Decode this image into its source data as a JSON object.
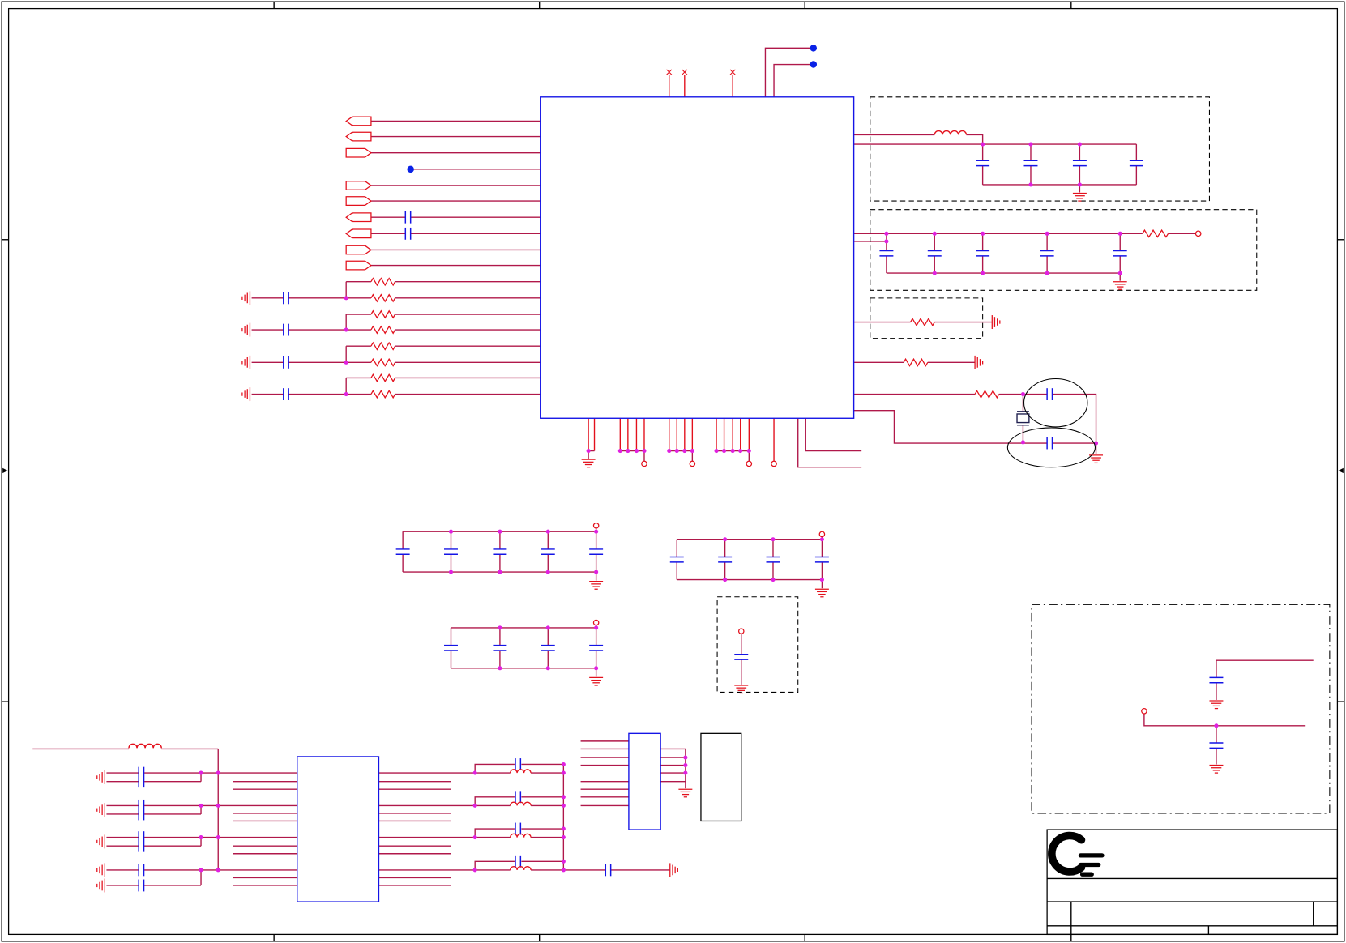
{
  "sheet": {
    "logo_icon": "company-logo-icon"
  },
  "colors": {
    "wire": "#b0184a",
    "pin": "#e3101c",
    "component": "#1414e6",
    "junction": "#e020e0",
    "offpage_dot": "#0a22e6",
    "frame": "#000000",
    "crystal": "#202050"
  }
}
